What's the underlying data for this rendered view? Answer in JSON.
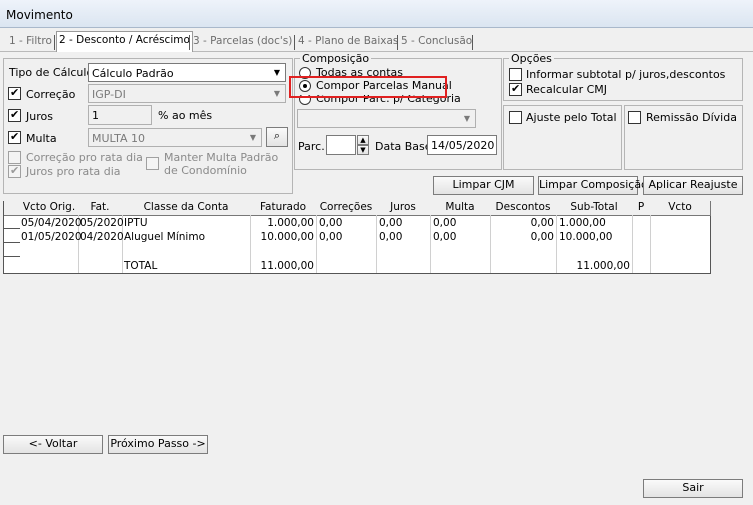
{
  "window": {
    "title": "Movimento"
  },
  "tabs": [
    {
      "label": "1 - Filtro",
      "active": false
    },
    {
      "label": "2 - Desconto / Acréscimo",
      "active": true
    },
    {
      "label": "3 - Parcelas (doc's)",
      "active": false
    },
    {
      "label": "4 - Plano de Baixas",
      "active": false
    },
    {
      "label": "5 - Conclusão",
      "active": false
    }
  ],
  "calc": {
    "tipo_label": "Tipo de Cálculo",
    "tipo_value": "Cálculo Padrão",
    "correcao_label": "Correção",
    "correcao_checked": true,
    "correcao_value": "IGP-DI",
    "juros_label": "Juros",
    "juros_checked": true,
    "juros_value": "1",
    "juros_unit": "% ao mês",
    "multa_label": "Multa",
    "multa_checked": true,
    "multa_value": "MULTA 10",
    "correcao_pro_rata": "Correção pro rata dia",
    "juros_pro_rata": "Juros pro rata dia",
    "manter_multa_line1": "Manter Multa Padrão",
    "manter_multa_line2": "de Condomínio"
  },
  "composicao": {
    "title": "Composição",
    "opt1": "Todas as contas",
    "opt2": "Compor Parcelas Manual",
    "opt3": "Compor Parc. p/ Categoria",
    "selected": "Compor Parcelas Manual",
    "parc_label": "Parc.",
    "data_base_label": "Data Base",
    "data_base_value": "14/05/2020"
  },
  "opcoes": {
    "title": "Opções",
    "informar_subtotal": "Informar subtotal p/ juros,descontos",
    "informar_checked": false,
    "recalcular_cmj": "Recalcular CMJ",
    "recalcular_checked": true,
    "ajuste_pelo_total": "Ajuste pelo Total",
    "remissao_divida": "Remissão Dívida"
  },
  "actions": {
    "limpar_cjm": "Limpar CJM",
    "limpar_composicao": "Limpar Composição",
    "aplicar_reajuste": "Aplicar Reajuste"
  },
  "grid": {
    "columns": [
      "Vcto Orig.",
      "Fat.",
      "Classe da Conta",
      "Faturado",
      "Correções",
      "Juros",
      "Multa",
      "Descontos",
      "Sub-Total",
      "P",
      "Vcto"
    ],
    "rows": [
      [
        "05/04/2020",
        "05/2020",
        "IPTU",
        "1.000,00",
        "0,00",
        "0,00",
        "0,00",
        "0,00",
        "1.000,00",
        "",
        ""
      ],
      [
        "01/05/2020",
        "04/2020",
        "Aluguel Mínimo",
        "10.000,00",
        "0,00",
        "0,00",
        "0,00",
        "0,00",
        "10.000,00",
        "",
        ""
      ]
    ],
    "total_label": "TOTAL",
    "total_faturado": "11.000,00",
    "total_subtotal": "11.000,00"
  },
  "nav": {
    "voltar": "<- Voltar",
    "proximo": "Próximo Passo ->",
    "sair": "Sair"
  },
  "colors": {
    "highlight": "#e02020"
  }
}
